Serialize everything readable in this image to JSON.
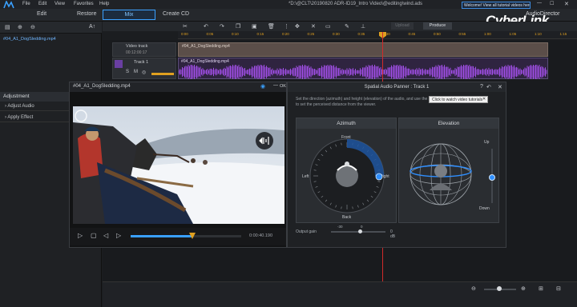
{
  "menu": {
    "file": "File",
    "edit": "Edit",
    "view": "View",
    "favorites": "Favorites",
    "help": "Help",
    "doc_title": "*D:\\@CLT\\20190820 ADR-ID19_Intro Video\\@editing\\wind.ads",
    "welcome": "Welcome! View all tutorial videos here!"
  },
  "tabs": {
    "edit": "Edit",
    "restore": "Restore",
    "mix": "Mix",
    "create_cd": "Create CD"
  },
  "brand": {
    "name": "CyberLink",
    "sub": "AudioDirector"
  },
  "library": {
    "font_size_label": "A↑",
    "file_name": "#04_A1_DogSledding.mp4"
  },
  "adjustment": {
    "header": "Adjustment",
    "items": [
      "Adjust Audio",
      "Apply Effect"
    ]
  },
  "timeline": {
    "toolbar": {
      "upload": "Upload",
      "produce": "Produce"
    },
    "ticks": [
      "0:00",
      "0:05",
      "0:10",
      "0:15",
      "0:20",
      "0:25",
      "0:30",
      "0:35",
      "0:40",
      "0:45",
      "0:50",
      "0:55",
      "1:00",
      "1:05",
      "1:10",
      "1:15"
    ],
    "video_track": {
      "name": "Video track",
      "time": "00:12:00:17",
      "clip": "#04_A1_DogSledding.mp4"
    },
    "audio_track": {
      "name": "Track 1",
      "clip": "#04_A1_DogSledding.mp4"
    }
  },
  "preview": {
    "title": "#04_A1_DogSledding.mp4",
    "ok": "OK",
    "time": "0:00:40.190",
    "progress": 0.56
  },
  "panner": {
    "title": "Spatial Audio Panner : Track 1",
    "description": "Set the direction (azimuth) and height (elevation) of the audio, and use the slider to set the perceived distance from the viewer.",
    "tutorial_tip": "Click to watch video tutorials",
    "azimuth": {
      "label": "Azimuth",
      "front": "Front",
      "left": "Left",
      "right": "Right",
      "back": "Back"
    },
    "elevation": {
      "label": "Elevation",
      "up": "Up",
      "down": "Down"
    },
    "output_gain": {
      "label": "Output gain",
      "min": "-30",
      "zero": "0",
      "value": "0 dB"
    }
  },
  "colors": {
    "accent": "#3aa0ff",
    "playhead": "#d12a2a",
    "waveform": "#a04ee6",
    "ruler_text": "#e0a020"
  }
}
